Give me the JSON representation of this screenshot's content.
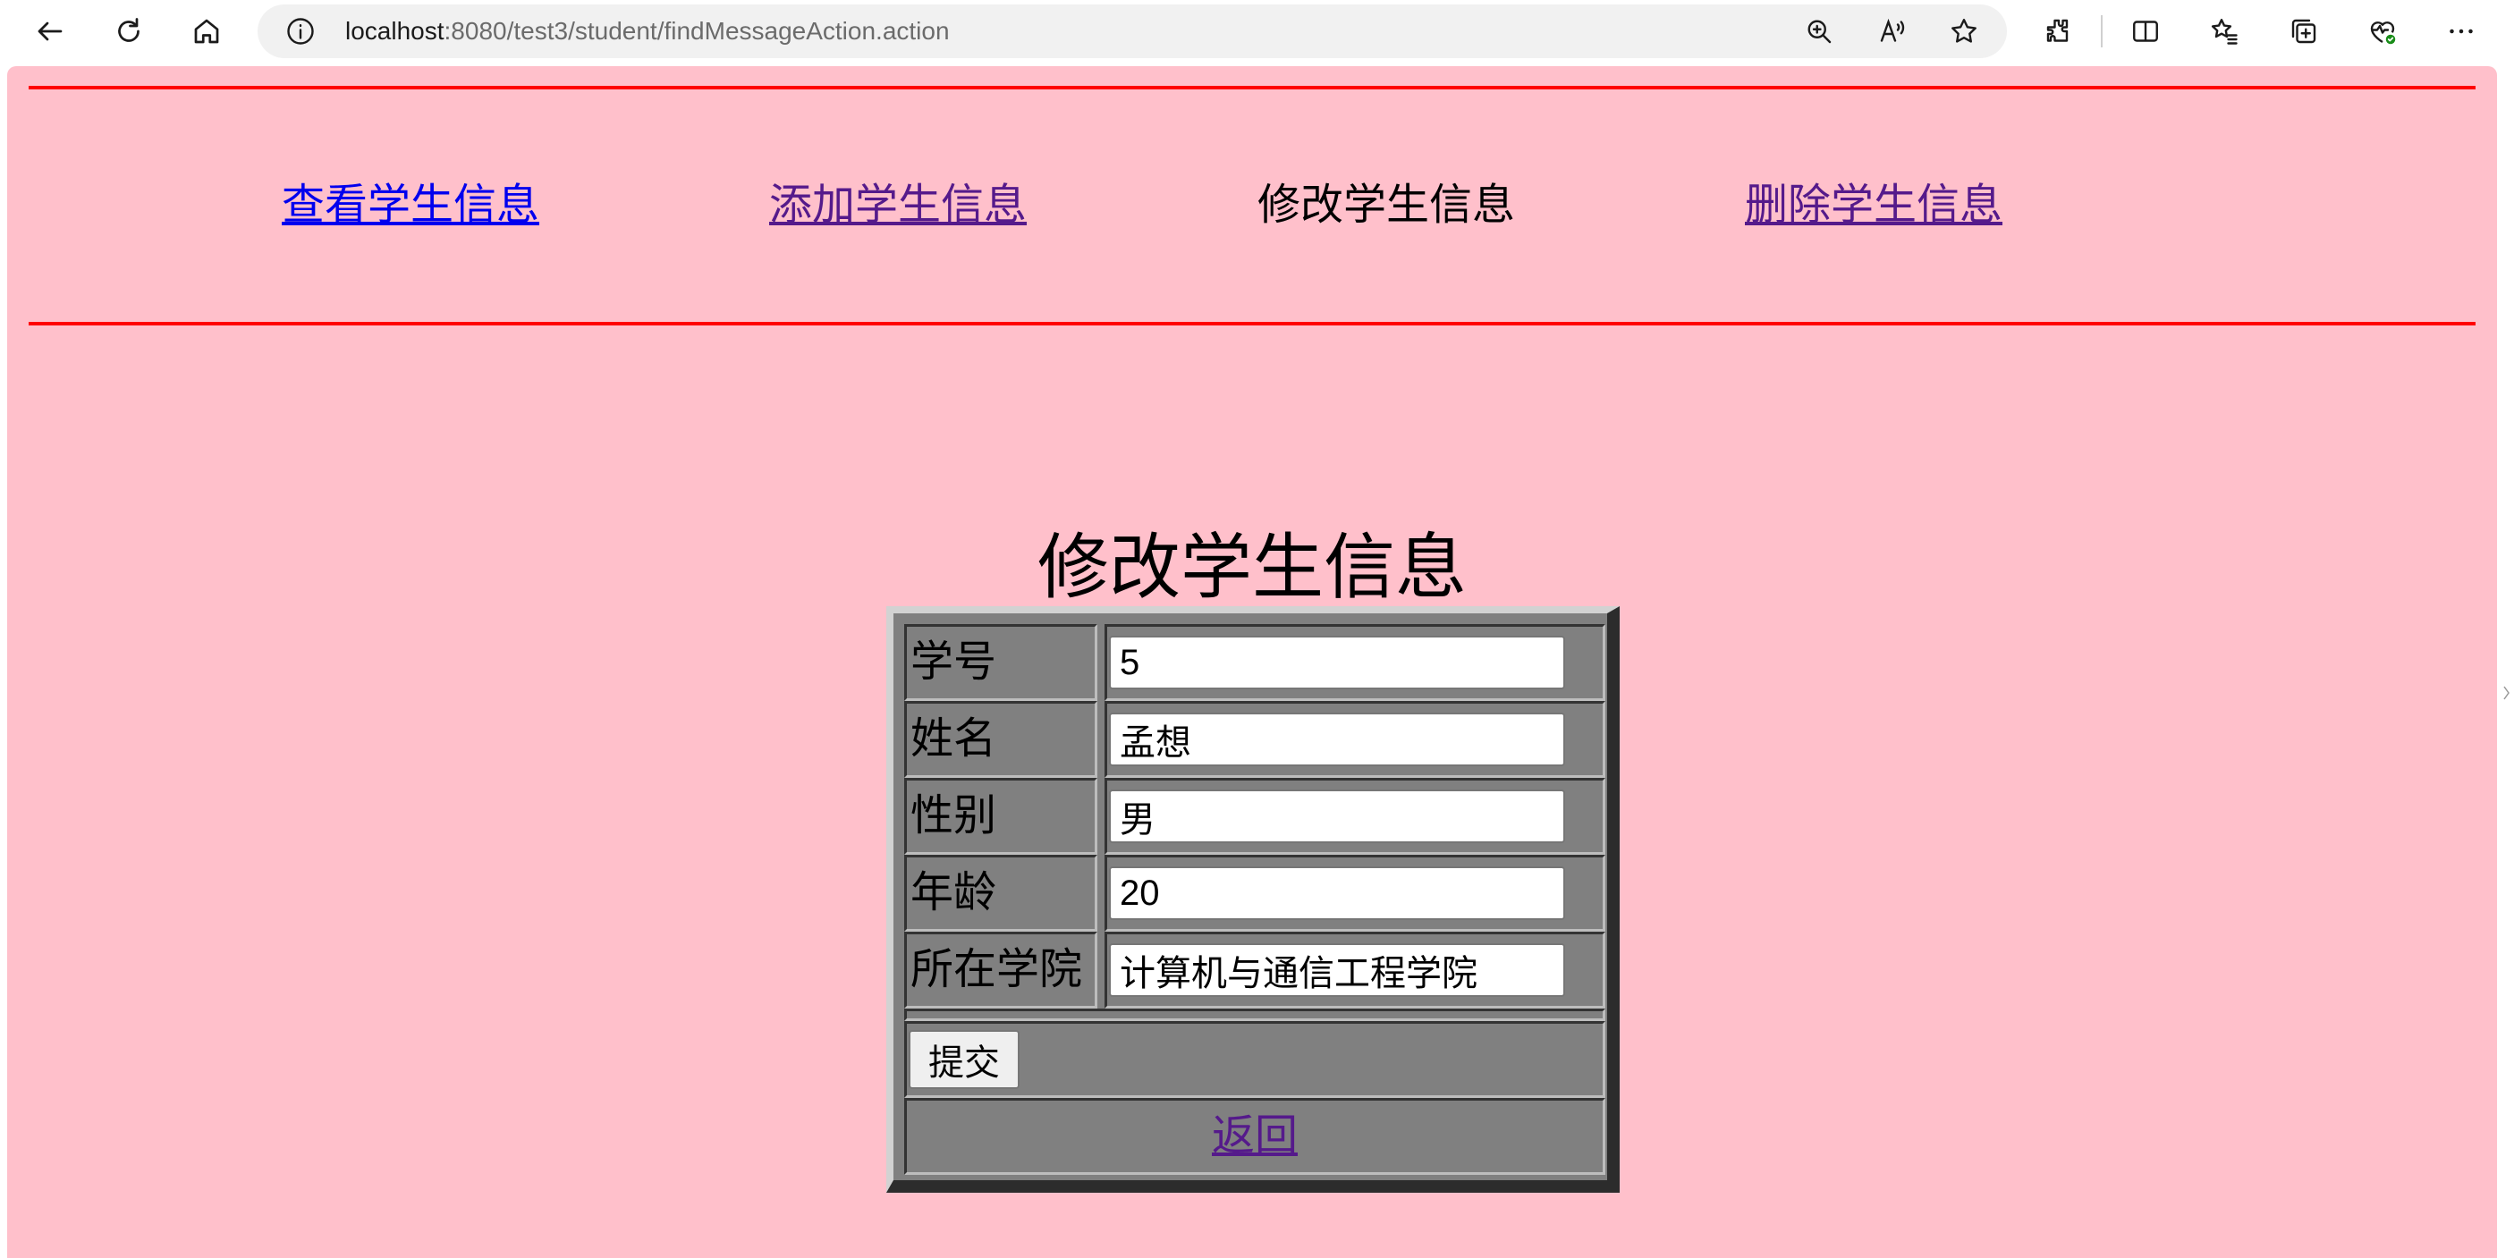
{
  "browser": {
    "url_host": "localhost",
    "url_rest": ":8080/test3/student/findMessageAction.action",
    "icons": [
      "back-arrow-icon",
      "refresh-icon",
      "home-icon",
      "info-icon",
      "zoom-icon",
      "read-aloud-icon",
      "favorite-star-icon",
      "extensions-icon",
      "split-screen-icon",
      "favorites-icon",
      "collections-icon",
      "browser-essentials-icon",
      "more-menu-icon"
    ]
  },
  "page": {
    "background": "#ffc0cb",
    "rule_color": "#ff0000",
    "nav": [
      {
        "label": "查看学生信息",
        "state": "link"
      },
      {
        "label": "添加学生信息",
        "state": "visited"
      },
      {
        "label": "修改学生信息",
        "state": "current"
      },
      {
        "label": "删除学生信息",
        "state": "visited"
      }
    ],
    "heading": "修改学生信息",
    "form": {
      "rows": [
        {
          "label": "学号",
          "value": "5"
        },
        {
          "label": "姓名",
          "value": "孟想"
        },
        {
          "label": "性别",
          "value": "男"
        },
        {
          "label": "年龄",
          "value": "20"
        },
        {
          "label": "所在学院",
          "value": "计算机与通信工程学院"
        }
      ],
      "submit_label": "提交",
      "back_label": "返回"
    }
  }
}
